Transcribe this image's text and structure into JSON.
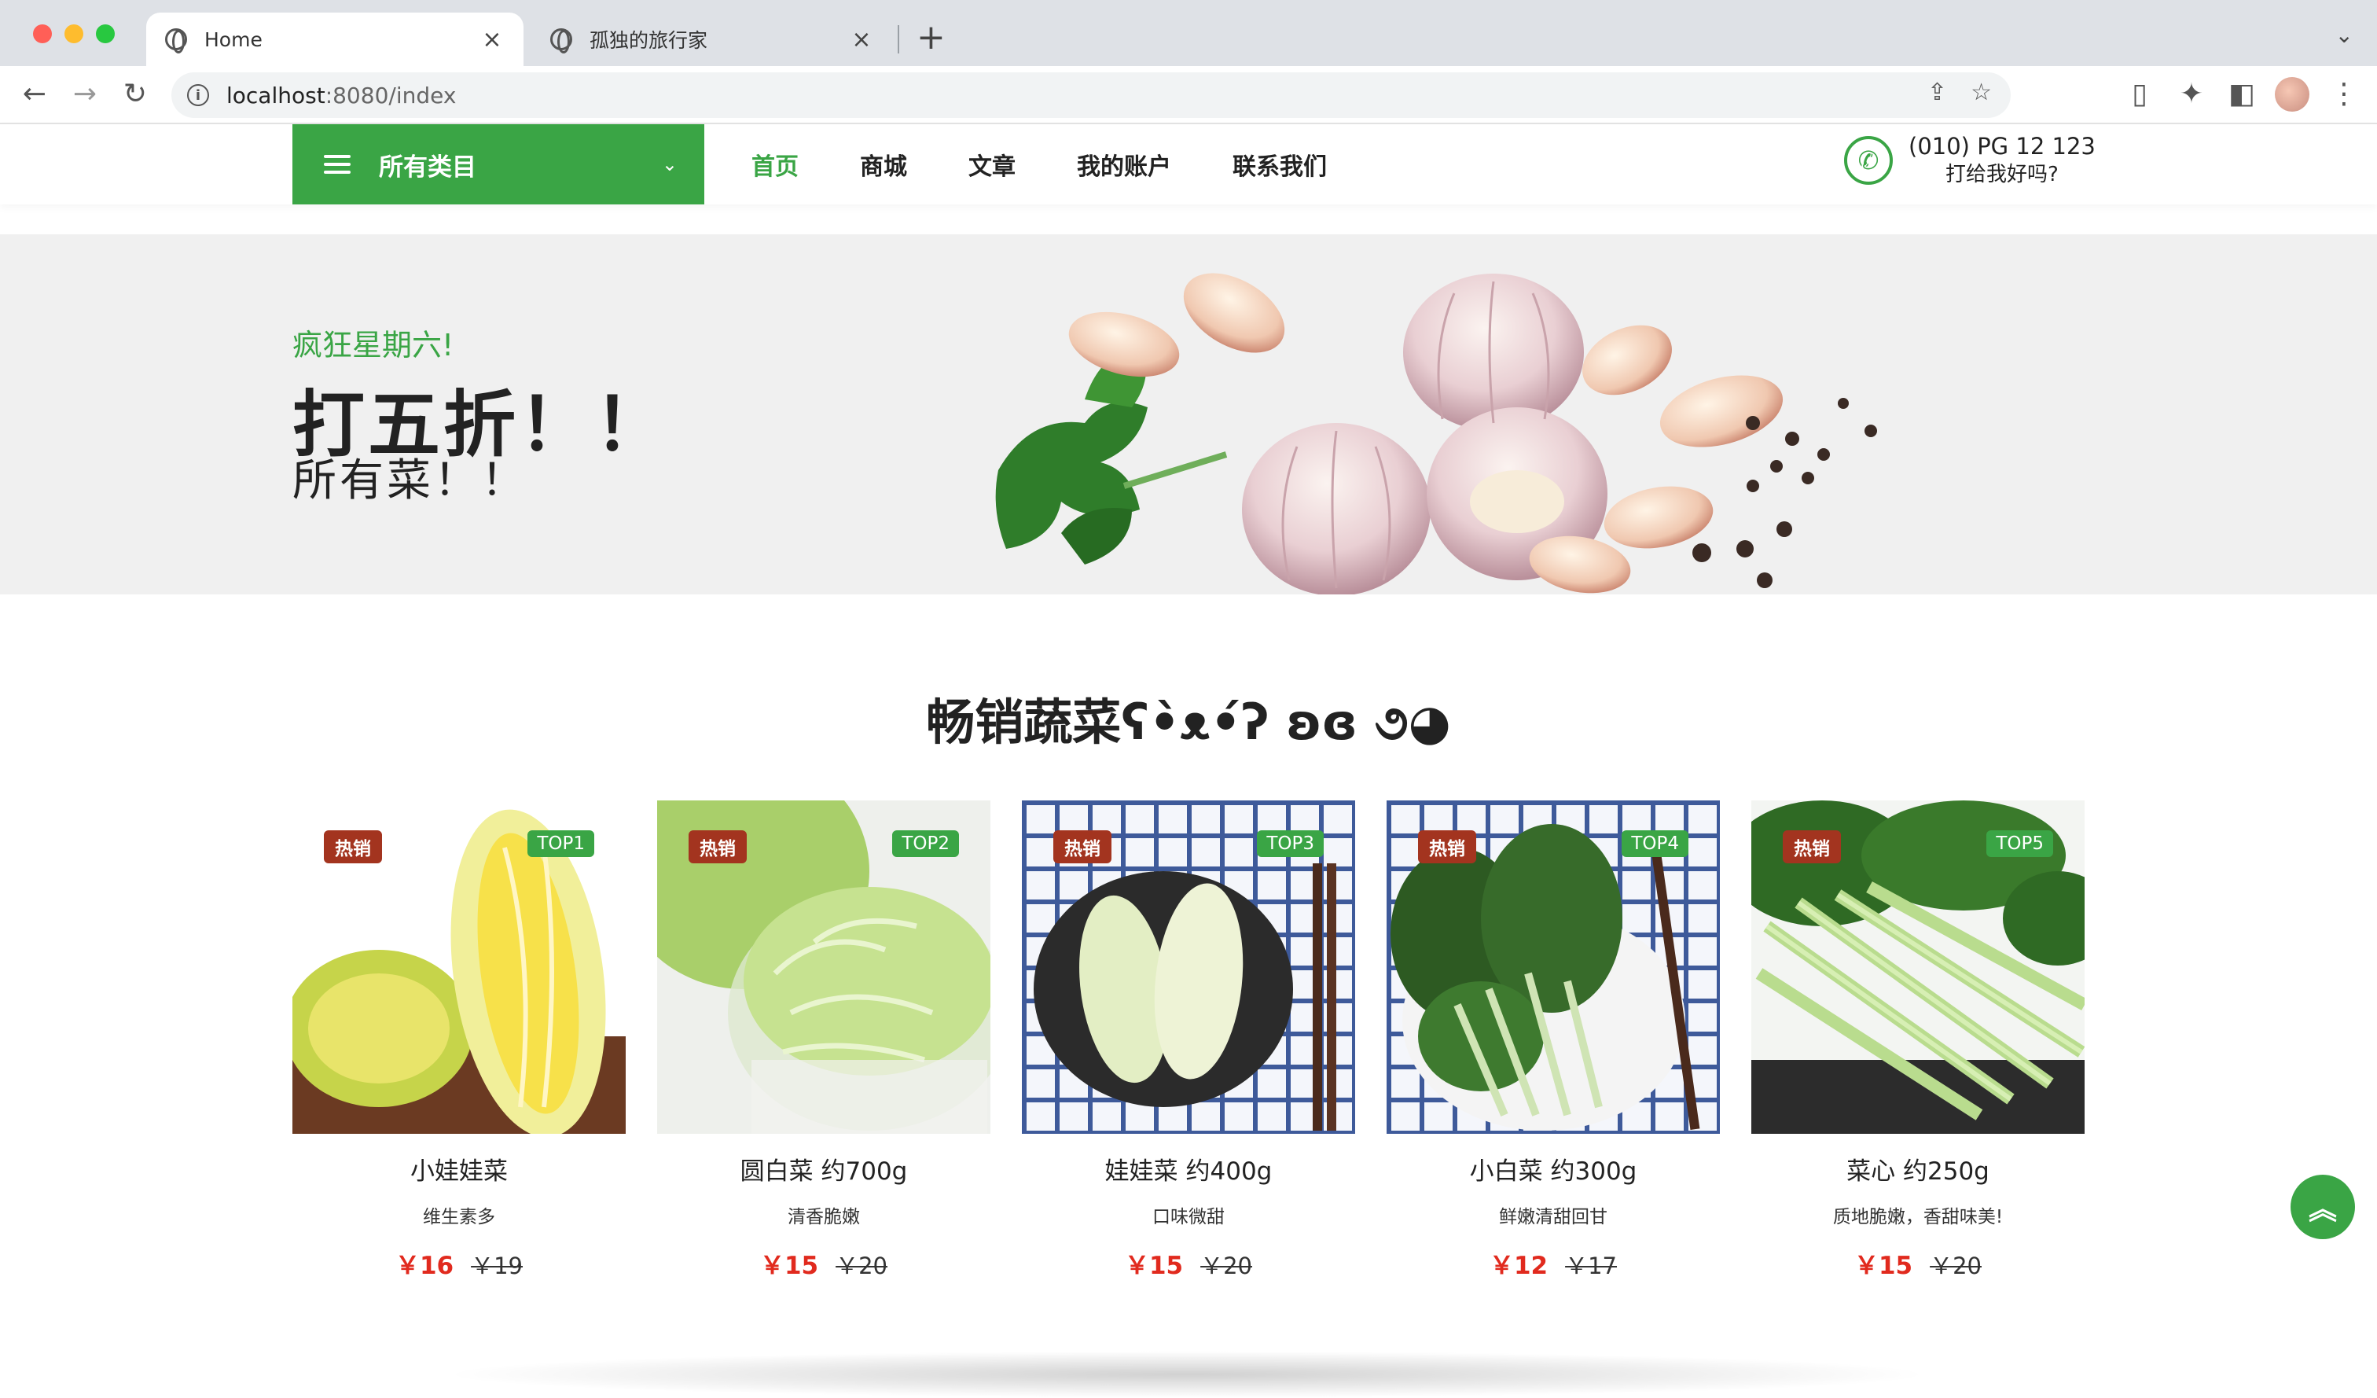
{
  "browser": {
    "tabs": [
      {
        "title": "Home",
        "active": true
      },
      {
        "title": "孤独的旅行家",
        "active": false
      }
    ],
    "url_host": "localhost",
    "url_path": ":8080/index"
  },
  "header": {
    "category_label": "所有类目",
    "nav": [
      "首页",
      "商城",
      "文章",
      "我的账户",
      "联系我们"
    ],
    "phone_number": "(010) PG 12 123",
    "phone_sub": "打给我好吗?",
    "accent_color": "#3aa545"
  },
  "hero": {
    "subtitle": "疯狂星期六!",
    "title": "打五折！！",
    "desc": "所有菜！！"
  },
  "section": {
    "title": "畅销蔬菜ʕ•̀ᴥ•́ʔ ʚɞ ૭◕"
  },
  "products": [
    {
      "name": "小娃娃菜",
      "desc": "维生素多",
      "price": "￥16",
      "old_price": "￥19",
      "hot": "热销",
      "rank": "TOP1"
    },
    {
      "name": "圆白菜 约700g",
      "desc": "清香脆嫩",
      "price": "￥15",
      "old_price": "￥20",
      "hot": "热销",
      "rank": "TOP2"
    },
    {
      "name": "娃娃菜 约400g",
      "desc": "口味微甜",
      "price": "￥15",
      "old_price": "￥20",
      "hot": "热销",
      "rank": "TOP3"
    },
    {
      "name": "小白菜 约300g",
      "desc": "鲜嫩清甜回甘",
      "price": "￥12",
      "old_price": "￥17",
      "hot": "热销",
      "rank": "TOP4"
    },
    {
      "name": "菜心 约250g",
      "desc": "质地脆嫩，香甜味美!",
      "price": "￥15",
      "old_price": "￥20",
      "hot": "热销",
      "rank": "TOP5"
    }
  ]
}
